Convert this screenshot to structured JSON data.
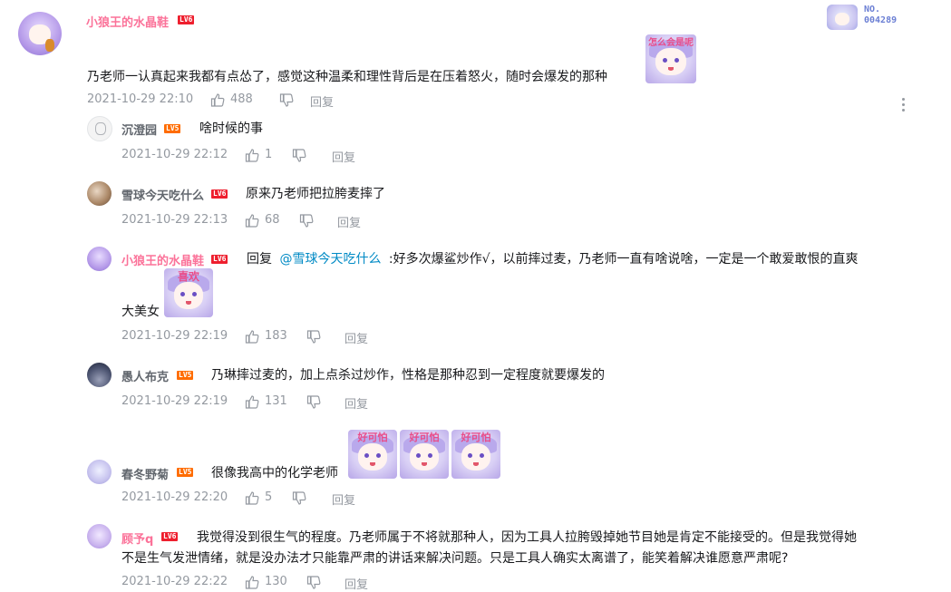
{
  "top_badge": {
    "line1": "NO.",
    "line2": "004289"
  },
  "root": {
    "username": "小狼王的水晶鞋",
    "level": "LV6",
    "content": "乃老师一认真起来我都有点怂了，感觉这种温柔和理性背后是在压着怒火，随时会爆发的那种",
    "sticker_label": "怎么会是呢",
    "time": "2021-10-29 22:10",
    "likes": "488",
    "reply": "回复"
  },
  "replies": [
    {
      "username": "沉澄园",
      "level": "LV5",
      "content": "啥时候的事",
      "time": "2021-10-29 22:12",
      "likes": "1",
      "reply": "回复"
    },
    {
      "username": "雪球今天吃什么",
      "level": "LV6",
      "content": "原来乃老师把拉胯麦摔了",
      "time": "2021-10-29 22:13",
      "likes": "68",
      "reply": "回复"
    },
    {
      "username": "小狼王的水晶鞋",
      "level": "LV6",
      "reply_prefix": "回复",
      "mention": "@雪球今天吃什么",
      "content": ":好多次爆鲨炒作√，以前摔过麦，乃老师一直有啥说啥，一定是一个敢爱敢恨的直爽",
      "content2": "大美女",
      "sticker_label": "喜欢",
      "time": "2021-10-29 22:19",
      "likes": "183",
      "reply": "回复"
    },
    {
      "username": "愚人布克",
      "level": "LV5",
      "content": "乃琳摔过麦的，加上点杀过炒作，性格是那种忍到一定程度就要爆发的",
      "time": "2021-10-29 22:19",
      "likes": "131",
      "reply": "回复"
    },
    {
      "username": "春冬野菊",
      "level": "LV5",
      "content": "很像我高中的化学老师",
      "sticker_label": "好可怕",
      "time": "2021-10-29 22:20",
      "likes": "5",
      "reply": "回复"
    },
    {
      "username": "顾予q",
      "level": "LV6",
      "content": "我觉得没到很生气的程度。乃老师属于不将就那种人，因为工具人拉胯毁掉她节目她是肯定不能接受的。但是我觉得她",
      "content2": "不是生气发泄情绪，就是没办法才只能靠严肃的讲话来解决问题。只是工具人确实太离谱了，能笑着解决谁愿意严肃呢?",
      "time": "2021-10-29 22:22",
      "likes": "130",
      "reply": "回复"
    }
  ],
  "colors": {
    "vip_pink": "#fb7299",
    "lv6": "#ee1f2e",
    "lv5": "#ff6c00",
    "link_blue": "#008ac5",
    "meta_gray": "#9499a0"
  }
}
